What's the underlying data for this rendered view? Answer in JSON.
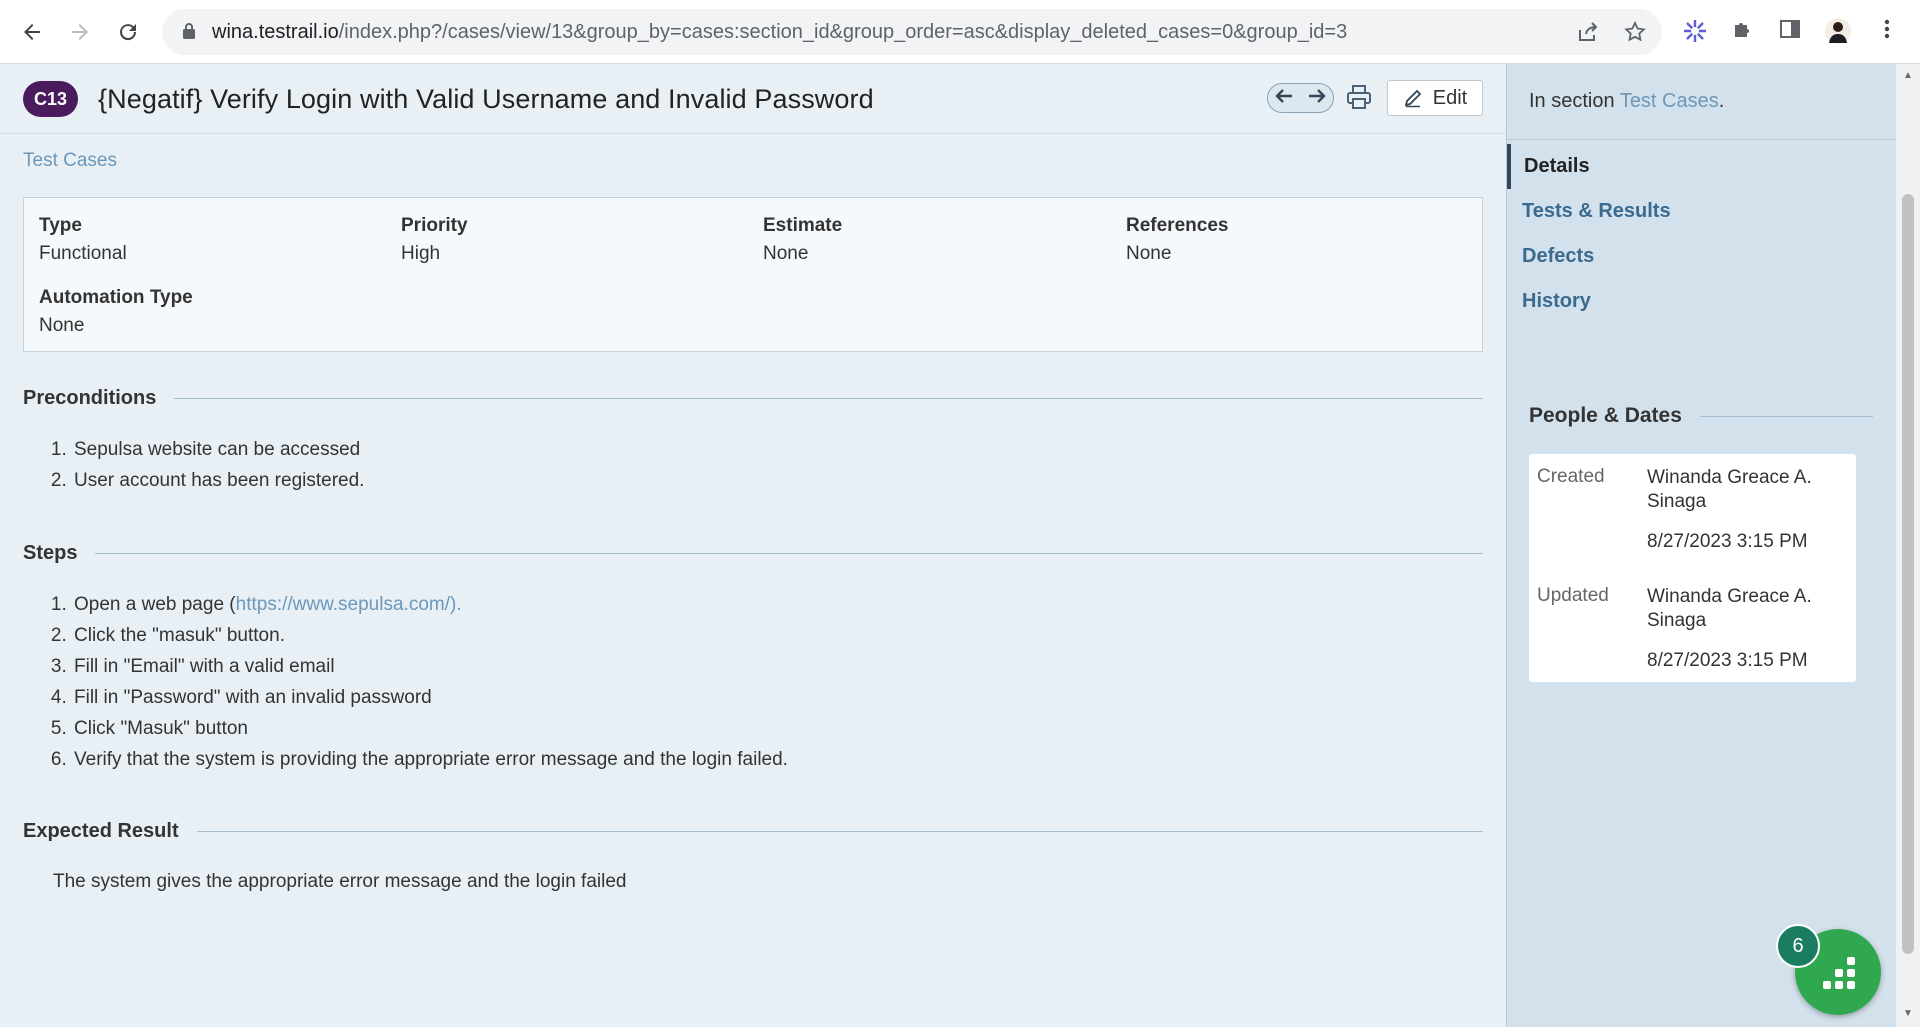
{
  "browser": {
    "url_host": "wina.testrail.io",
    "url_rest": "/index.php?/cases/view/13&group_by=cases:section_id&group_order=asc&display_deleted_cases=0&group_id=3"
  },
  "case": {
    "id_badge": "C13",
    "title": "{Negatif} Verify Login with Valid Username and Invalid Password",
    "edit_label": "Edit",
    "breadcrumb": "Test Cases"
  },
  "fields": [
    {
      "label": "Type",
      "value": "Functional"
    },
    {
      "label": "Priority",
      "value": "High"
    },
    {
      "label": "Estimate",
      "value": "None"
    },
    {
      "label": "References",
      "value": "None"
    },
    {
      "label": "Automation Type",
      "value": "None"
    }
  ],
  "preconditions": {
    "heading": "Preconditions",
    "items": [
      "Sepulsa website can be accessed",
      "User account has been registered."
    ]
  },
  "steps": {
    "heading": "Steps",
    "step1_prefix": "Open a web page (",
    "step1_link": "https://www.sepulsa.com/).",
    "items": [
      "Click the \"masuk\" button.",
      "Fill in \"Email\" with a valid email",
      "Fill in \"Password\" with an invalid password",
      "Click \"Masuk\" button",
      "Verify that the system is providing the appropriate error message and the login failed."
    ]
  },
  "expected": {
    "heading": "Expected Result",
    "text": "The system gives the appropriate error message and the login failed"
  },
  "sidebar": {
    "section_prefix": "In section ",
    "section_link": "Test Cases",
    "section_suffix": ".",
    "nav": [
      "Details",
      "Tests & Results",
      "Defects",
      "History"
    ],
    "people_heading": "People & Dates",
    "created_label": "Created",
    "created_by": "Winanda Greace A. Sinaga",
    "created_date": "8/27/2023 3:15 PM",
    "updated_label": "Updated",
    "updated_by": "Winanda Greace A. Sinaga",
    "updated_date": "8/27/2023 3:15 PM"
  },
  "fab": {
    "count": "6"
  }
}
